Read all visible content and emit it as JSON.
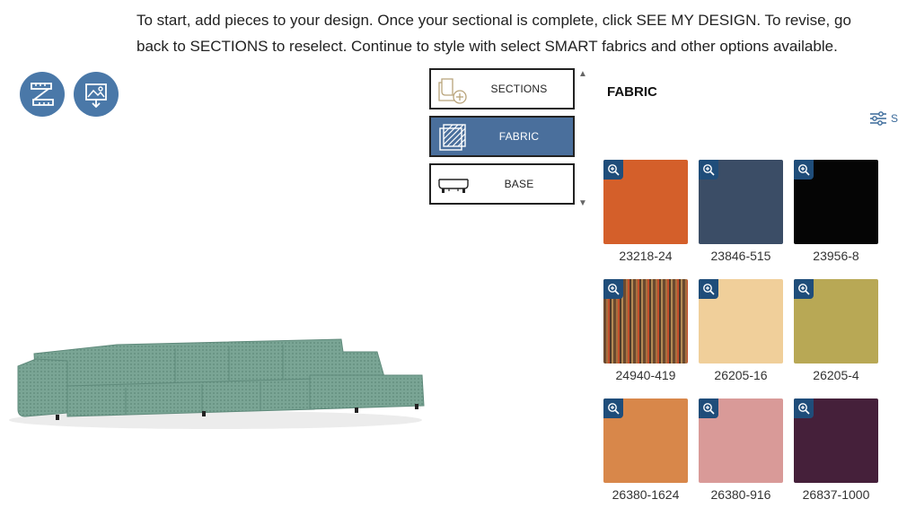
{
  "intro_text": "To start, add pieces to your design. Once your sectional is complete, click SEE MY DESIGN. To revise, go back to SECTIONS to reselect. Continue to style with select SMART fabrics and other options available.",
  "tools": [
    {
      "icon": "measure-icon"
    },
    {
      "icon": "save-image-icon"
    }
  ],
  "steps": [
    {
      "label": "SECTIONS",
      "icon": "sections-icon"
    },
    {
      "label": "FABRIC",
      "icon": "fabric-icon",
      "active": true
    },
    {
      "label": "BASE",
      "icon": "base-icon"
    }
  ],
  "fabric_title": "FABRIC",
  "filter_label": "S",
  "swatches": [
    {
      "code": "23218-24",
      "color": "#d45f2a"
    },
    {
      "code": "23846-515",
      "color": "#3b4d66"
    },
    {
      "code": "23956-8",
      "color": "#050505"
    },
    {
      "code": "24940-419",
      "color": "#8a5a3a"
    },
    {
      "code": "26205-16",
      "color": "#f0cf9a"
    },
    {
      "code": "26205-4",
      "color": "#b8a855"
    },
    {
      "code": "26380-1624",
      "color": "#d8874a"
    },
    {
      "code": "26380-916",
      "color": "#d99a98"
    },
    {
      "code": "26837-1000",
      "color": "#45203a"
    }
  ],
  "colors": {
    "accent": "#4a78a8",
    "active_step": "#4a6f9c",
    "zoom_badge": "#1f4d7a",
    "sofa": "#7aa595"
  }
}
